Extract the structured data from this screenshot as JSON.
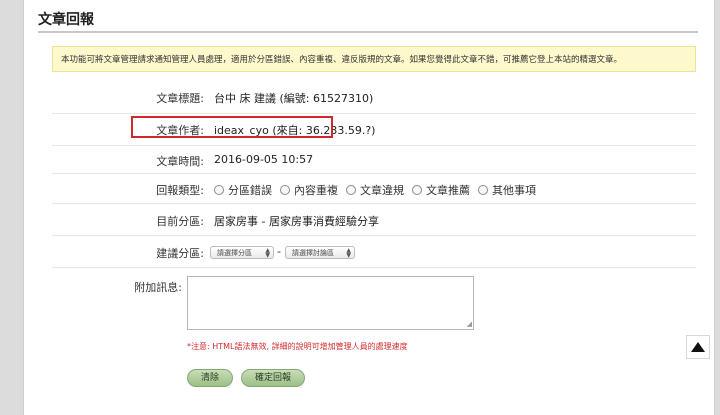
{
  "page": {
    "title": "文章回報",
    "notice": "本功能可將文章管理請求通知管理人員處理，適用於分區錯誤、內容重複、違反版規的文章。如果您覺得此文章不錯，可推薦它登上本站的精選文章。"
  },
  "fields": {
    "article_title_label": "文章標題:",
    "article_title_value": "台中 床 建議 (編號: 61527310)",
    "author_label": "文章作者:",
    "author_value": "ideax_cyo (來自: 36.233.59.?)",
    "time_label": "文章時間:",
    "time_value": "2016-09-05 10:57",
    "report_type_label": "回報類型:",
    "report_types": [
      "分區錯誤",
      "內容重複",
      "文章違規",
      "文章推薦",
      "其他事項"
    ],
    "current_section_label": "目前分區:",
    "current_section_value": "居家房事 - 居家房事消費經驗分享",
    "suggest_section_label": "建議分區:",
    "section_select": "請選擇分區",
    "dash": "-",
    "forum_select": "請選擇討論區",
    "extra_message_label": "附加訊息:",
    "warning": "*注意: HTML語法無效, 詳細的說明可增加管理人員的處理速度"
  },
  "buttons": {
    "clear": "清除",
    "confirm": "確定回報"
  },
  "colors": {
    "highlight_border": "#d0262c",
    "notice_bg": "#fdf9cc",
    "button_green": "#9cbf86",
    "warning_text": "#d42a2a"
  }
}
